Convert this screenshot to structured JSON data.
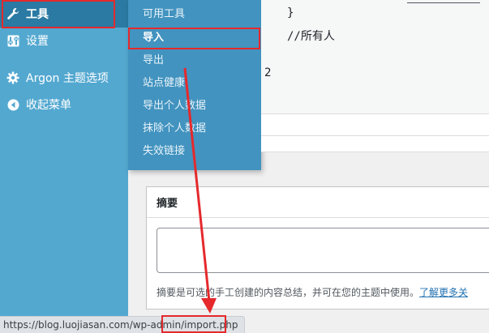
{
  "sidebar": {
    "items": [
      {
        "label": "工具",
        "icon": "wrench-icon"
      },
      {
        "label": "设置",
        "icon": "settings-icon"
      },
      {
        "label": "Argon 主题选项",
        "icon": "gear-icon"
      },
      {
        "label": "收起菜单",
        "icon": "collapse-icon"
      }
    ]
  },
  "flyout": {
    "items": [
      {
        "label": "可用工具"
      },
      {
        "label": "导入"
      },
      {
        "label": "导出"
      },
      {
        "label": "站点健康"
      },
      {
        "label": "导出个人数据"
      },
      {
        "label": "抹除个人数据"
      },
      {
        "label": "失效链接"
      }
    ]
  },
  "code": {
    "line_brace": "}",
    "line_comment": "//所有人",
    "line_num": "2"
  },
  "excerpt": {
    "title": "摘要",
    "help_text": "摘要是可选的手工创建的内容总结，并可在您的主题中使用。",
    "help_link": "了解更多关"
  },
  "statusbar": {
    "url_prefix": "https://blog.luojiasan.com/wp-admin/",
    "url_file": "import.php"
  },
  "colors": {
    "sidebar": "#53a8d0",
    "flyout": "#4293bf",
    "highlight": "#e5292c"
  }
}
